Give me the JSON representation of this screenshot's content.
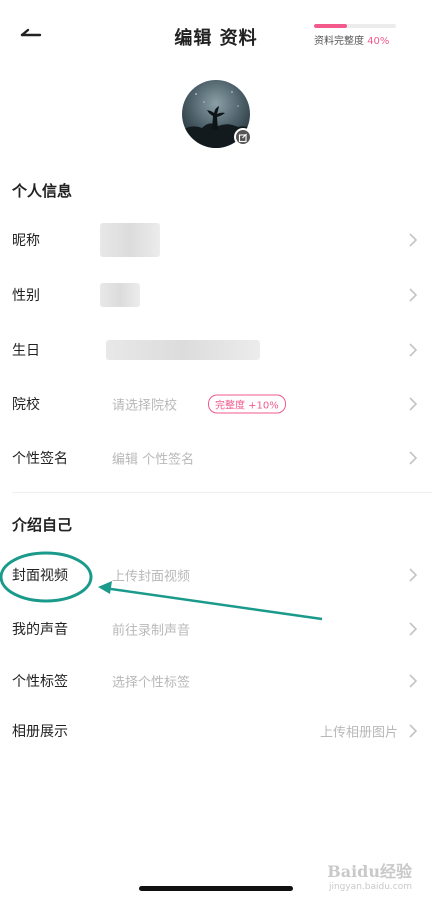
{
  "header": {
    "title": "编辑 资料",
    "completeness_label": "资料完整度",
    "completeness_value": "40%",
    "completeness_fraction": 0.4
  },
  "sections": {
    "personal_title": "个人信息",
    "intro_title": "介绍自己"
  },
  "personal_rows": {
    "nickname_label": "昵称",
    "gender_label": "性别",
    "birthday_label": "生日",
    "school_label": "院校",
    "school_placeholder": "请选择院校",
    "school_badge": "完整度 +10%",
    "signature_label": "个性签名",
    "signature_placeholder": "编辑 个性签名"
  },
  "intro_rows": {
    "cover_video_label": "封面视频",
    "cover_video_placeholder": "上传封面视频",
    "voice_label": "我的声音",
    "voice_placeholder": "前往录制声音",
    "tags_label": "个性标签",
    "tags_placeholder": "选择个性标签",
    "album_label": "相册展示",
    "album_placeholder": "上传相册图片"
  },
  "watermark": {
    "brand": "Baidu经验",
    "url": "jingyan.baidu.com"
  },
  "colors": {
    "accent": "#f25a8c",
    "annotation": "#1a9a8a",
    "placeholder_text": "#b8b8b8"
  },
  "icons": {
    "back": "arrow-left-icon",
    "chevron": "chevron-right-icon",
    "avatar_edit": "edit-icon"
  }
}
